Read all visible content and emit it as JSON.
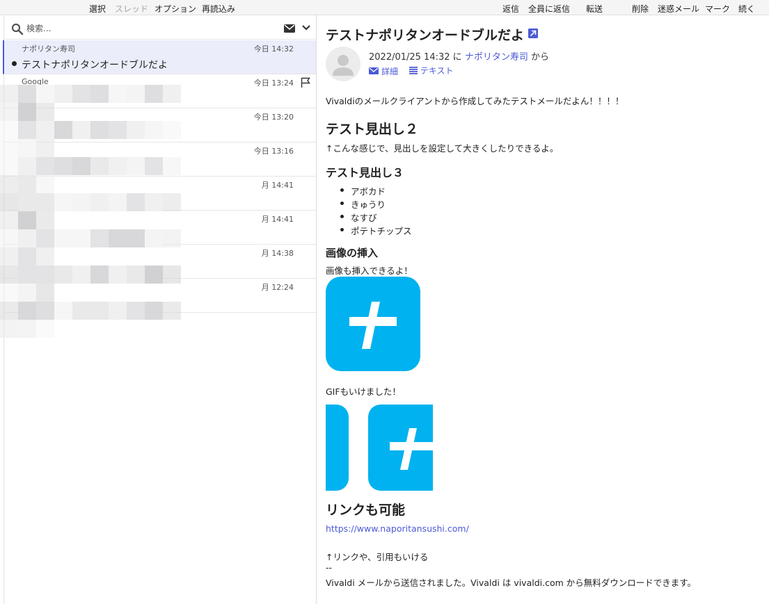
{
  "left_toolbar": {
    "select": "選択",
    "thread": "スレッド",
    "options": "オプション",
    "reload": "再読込み"
  },
  "right_toolbar": {
    "reply": "返信",
    "reply_all": "全員に返信",
    "forward": "転送",
    "delete": "削除",
    "spam": "迷惑メール",
    "mark": "マーク",
    "more": "続く"
  },
  "search": {
    "placeholder": "検索..."
  },
  "mail_list": [
    {
      "sender": "ナポリタン寿司",
      "time": "今日 14:32",
      "subject": "テストナポリタンオードブルだよ",
      "unread": true,
      "selected": true
    },
    {
      "sender": "Google",
      "time": "今日 13:24",
      "flagged": true
    },
    {
      "sender": "",
      "time": "今日 13:20"
    },
    {
      "sender": "",
      "time": "今日 13:16"
    },
    {
      "sender": "",
      "time": "月 14:41"
    },
    {
      "sender": "",
      "time": "月 14:41"
    },
    {
      "sender": "",
      "time": "月 14:38"
    },
    {
      "sender": "",
      "time": "月 12:24"
    }
  ],
  "message": {
    "subject": "テストナポリタンオードブルだよ",
    "date": "2022/01/25 14:32",
    "to_word": "に",
    "sender": "ナポリタン寿司",
    "from_word": "から",
    "details_label": "詳細",
    "text_label": "テキスト"
  },
  "body": {
    "intro": "Vivaldiのメールクライアントから作成してみたテストメールだよん！！！！",
    "heading2": "テスト見出し２",
    "heading2_text": "↑こんな感じで、見出しを設定して大きくしたりできるよ。",
    "heading3": "テスト見出し３",
    "list": [
      "アボカド",
      "きゅうり",
      "なすび",
      "ポテトチップス"
    ],
    "image_heading": "画像の挿入",
    "image_text": "画像も挿入できるよ！",
    "gif_text": "GIFもいけました！",
    "link_heading": "リンクも可能",
    "link_url": "https://www.naporitansushi.com/",
    "link_note": "↑リンクや、引用もいける",
    "sig_sep": "--",
    "signature": "Vivaldi メールから送信されました。Vivaldi は vivaldi.com から無料ダウンロードできます。"
  },
  "colors": {
    "accent": "#4b5ad6",
    "logo": "#00b2ef",
    "selected_row": "#ebedfb"
  }
}
